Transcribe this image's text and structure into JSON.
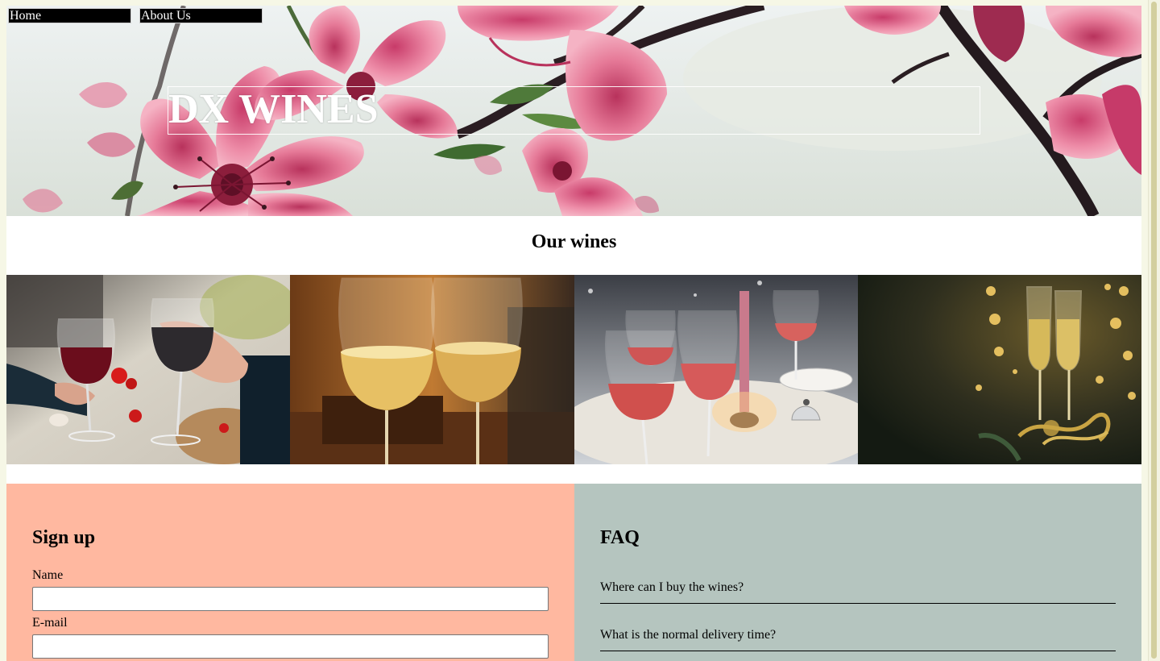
{
  "nav": {
    "items": [
      {
        "label": "Home"
      },
      {
        "label": "About Us"
      }
    ]
  },
  "hero": {
    "title": "DX WINES",
    "image": "pink-blossom-branch"
  },
  "wines": {
    "title": "Our wines",
    "photos": [
      {
        "name": "red-wine-toast-photo"
      },
      {
        "name": "white-wine-glasses-photo"
      },
      {
        "name": "rose-wine-table-photo"
      },
      {
        "name": "champagne-flutes-photo"
      }
    ]
  },
  "signup": {
    "title": "Sign up",
    "name_label": "Name",
    "name_value": "",
    "email_label": "E-mail",
    "email_value": "",
    "background": "#ffb8a0"
  },
  "faq": {
    "title": "FAQ",
    "items": [
      {
        "question": "Where can I buy the wines?"
      },
      {
        "question": "What is the normal delivery time?"
      }
    ],
    "background": "#b5c5bf"
  }
}
